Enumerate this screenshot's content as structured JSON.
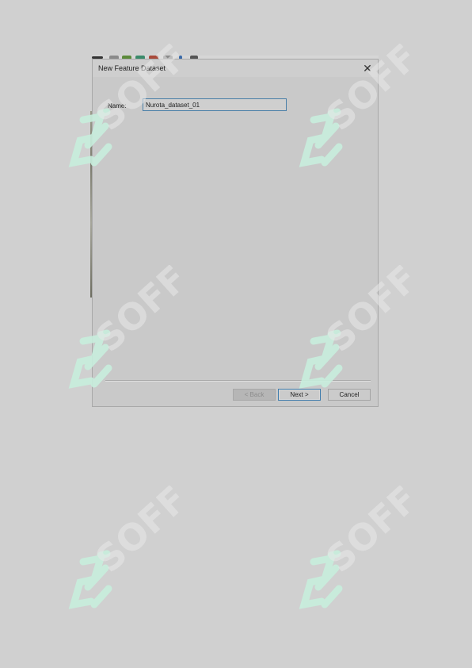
{
  "dialog": {
    "title": "New Feature Dataset",
    "close_glyph": "✕",
    "name_label": "Name:",
    "name_value": "Nurota_dataset_01",
    "buttons": {
      "back": "< Back",
      "next": "Next >",
      "cancel": "Cancel"
    },
    "back_enabled": false
  },
  "watermark": {
    "text": "SOFF",
    "logo_icon": "double-s-logo-icon",
    "color": "#c8eedd"
  },
  "colors": {
    "page": "#d0d0d0",
    "dialog": "#c9c9c9",
    "focus_border": "#3f7cac"
  }
}
